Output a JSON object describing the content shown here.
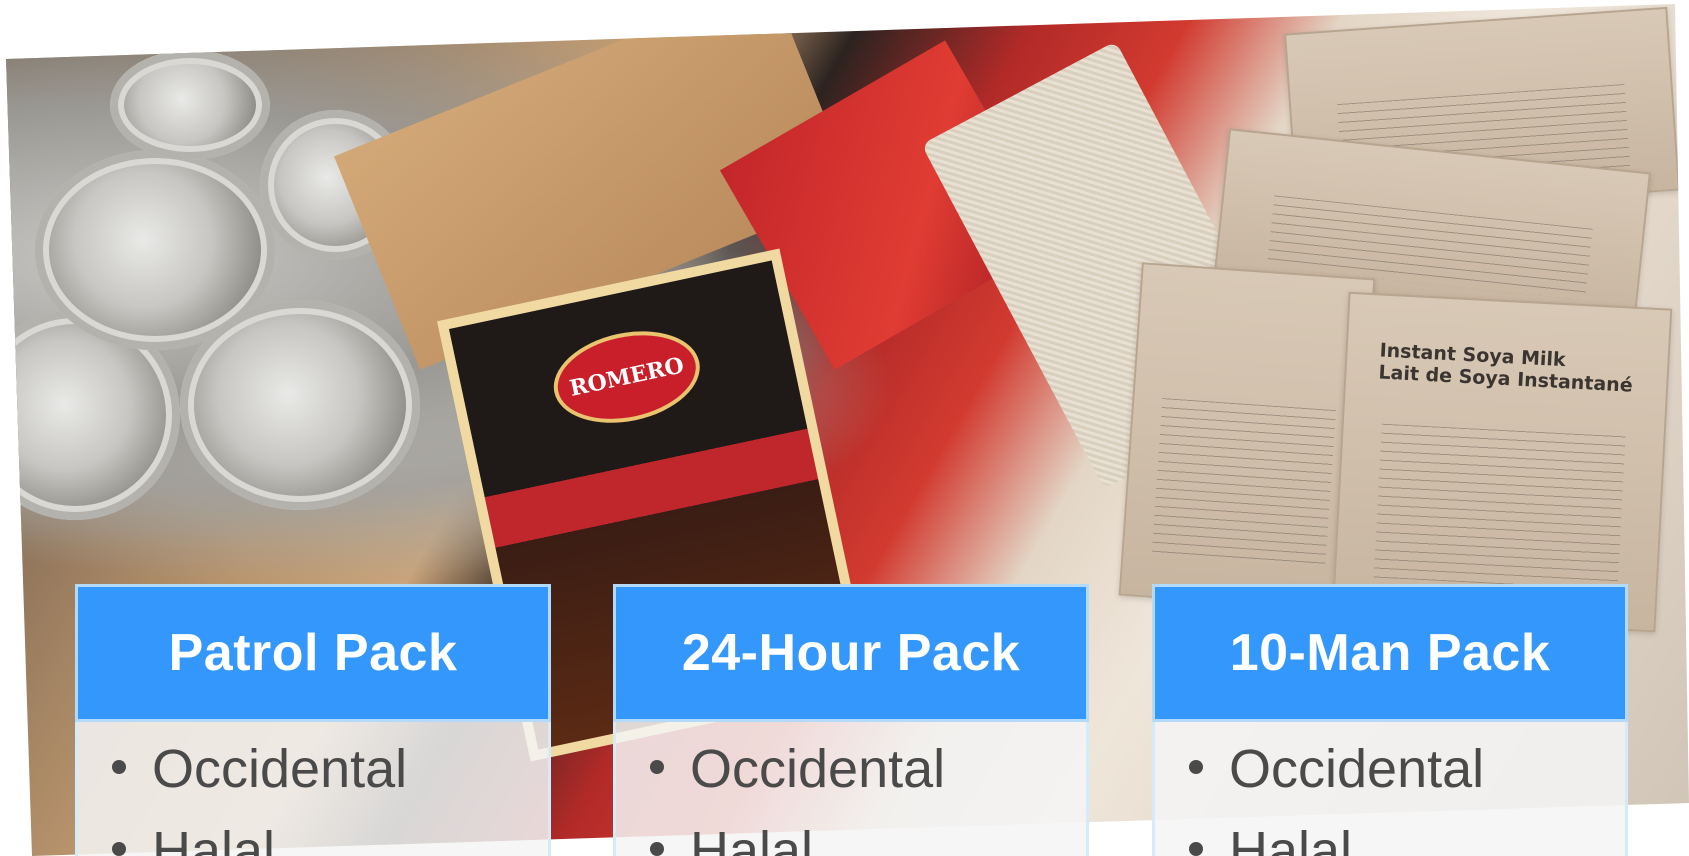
{
  "photo": {
    "brand_label": "ROMERO",
    "sachet_label_line1": "Instant Soya Milk",
    "sachet_label_line2": "Lait de Soya Instantané"
  },
  "cards": [
    {
      "title": "Patrol Pack",
      "items": [
        "Occidental",
        "Halal"
      ]
    },
    {
      "title": "24-Hour Pack",
      "items": [
        "Occidental",
        "Halal"
      ]
    },
    {
      "title": "10-Man Pack",
      "items": [
        "Occidental",
        "Halal"
      ]
    }
  ],
  "colors": {
    "header_blue": "#3497fb",
    "header_border": "#b3d9fb",
    "body_bg": "#f4f4f4",
    "bullet_text": "#4a4a4a"
  }
}
